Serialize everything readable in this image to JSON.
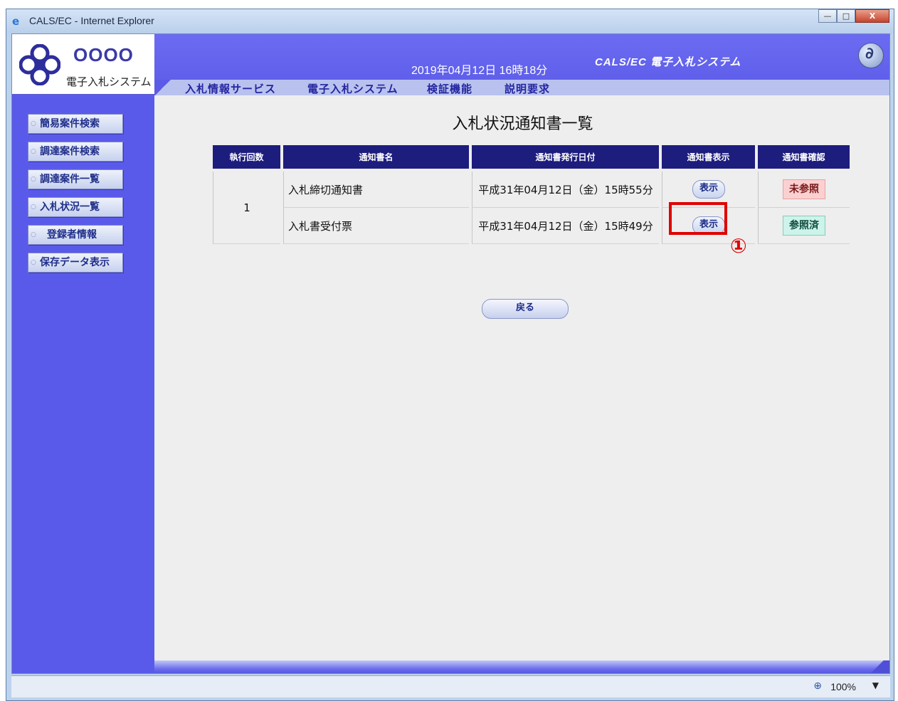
{
  "window": {
    "title": "CALS/EC - Internet Explorer",
    "minimize": "—",
    "restore": "□",
    "close": "X"
  },
  "header": {
    "org": "OOOO",
    "system_name": "電子入札システム",
    "datetime": "2019年04月12日 16時18分",
    "brand": "CALS/EC 電子入札システム"
  },
  "menu": {
    "items": [
      "入札情報サービス",
      "電子入札システム",
      "検証機能",
      "説明要求"
    ]
  },
  "sidebar": {
    "items": [
      "簡易案件検索",
      "調達案件検索",
      "調達案件一覧",
      "入札状況一覧",
      "登録者情報",
      "保存データ表示"
    ]
  },
  "page": {
    "title": "入札状況通知書一覧",
    "back_label": "戻る",
    "marker": "①"
  },
  "table": {
    "headers": [
      "執行回数",
      "通知書名",
      "通知書発行日付",
      "通知書表示",
      "通知書確認"
    ],
    "round": "1",
    "rows": [
      {
        "name": "入札締切通知書",
        "date": "平成31年04月12日（金）15時55分",
        "show": "表示",
        "status": "未参照"
      },
      {
        "name": "入札書受付票",
        "date": "平成31年04月12日（金）15時49分",
        "show": "表示",
        "status": "参照済"
      }
    ]
  },
  "statusbar": {
    "zoom": "100%"
  },
  "colors": {
    "header_blue": "#5b5be8",
    "table_header": "#1d1d7e",
    "unread": "#fbd0d0",
    "read": "#cdf3ea",
    "highlight": "#e00000"
  }
}
